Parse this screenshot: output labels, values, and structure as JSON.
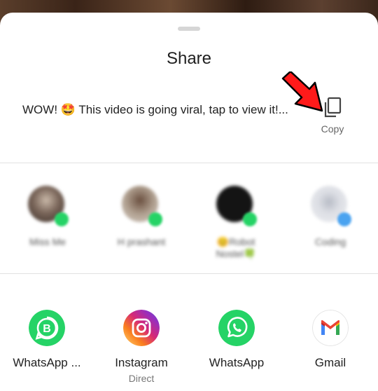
{
  "sheet": {
    "title": "Share",
    "message": "WOW! 🤩 This video is going viral, tap to view it!...",
    "copy_label": "Copy"
  },
  "contacts": [
    {
      "name": "Miss Me",
      "avatar_color": "#5a4a40",
      "badge_color": "#25d366"
    },
    {
      "name": "H prashant",
      "avatar_color": "#9a8a7a",
      "badge_color": "#25d366"
    },
    {
      "name": "😊Robot Nostel🍀",
      "avatar_color": "#1a1a1a",
      "badge_color": "#25d366"
    },
    {
      "name": "Coding",
      "avatar_color": "#e6e6ea",
      "badge_color": "#4aa3f0"
    }
  ],
  "apps": [
    {
      "label": "WhatsApp ...",
      "sublabel": "",
      "icon": "whatsapp-business-icon",
      "color": "#25d366"
    },
    {
      "label": "Instagram",
      "sublabel": "Direct",
      "icon": "instagram-icon",
      "color": "#e1306c"
    },
    {
      "label": "WhatsApp",
      "sublabel": "",
      "icon": "whatsapp-icon",
      "color": "#25d366"
    },
    {
      "label": "Gmail",
      "sublabel": "",
      "icon": "gmail-icon",
      "color": "#ea4335"
    }
  ]
}
